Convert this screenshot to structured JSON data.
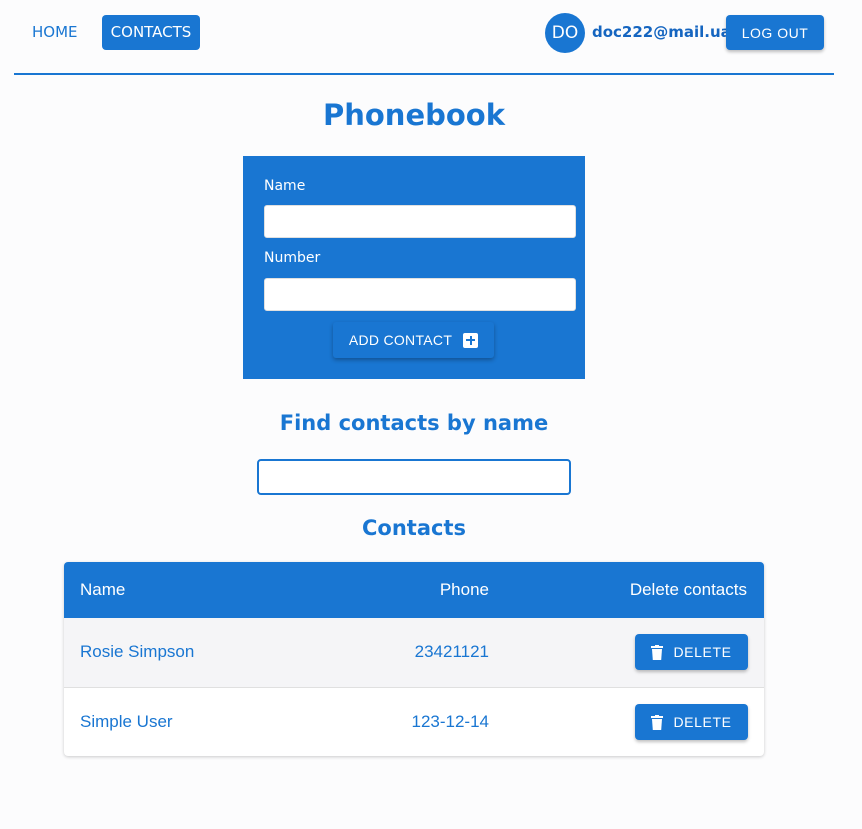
{
  "nav": {
    "home_label": "HOME",
    "contacts_label": "CONTACTS",
    "avatar_initials": "DO",
    "user_email": "doc222@mail.ua",
    "logout_label": "LOG OUT"
  },
  "page_title": "Phonebook",
  "form": {
    "name_label": "Name",
    "name_value": "",
    "number_label": "Number",
    "number_value": "",
    "add_label": "ADD CONTACT",
    "add_icon": "add-box-icon"
  },
  "filter": {
    "title": "Find contacts by name",
    "value": ""
  },
  "contacts": {
    "title": "Contacts",
    "columns": [
      "Name",
      "Phone",
      "Delete contacts"
    ],
    "rows": [
      {
        "name": "Rosie Simpson",
        "phone": "23421121",
        "delete_label": "DELETE"
      },
      {
        "name": "Simple User",
        "phone": "123-12-14",
        "delete_label": "DELETE"
      }
    ],
    "delete_icon": "trash-icon"
  },
  "colors": {
    "primary": "#1976d2",
    "background": "#fcfcfd"
  }
}
